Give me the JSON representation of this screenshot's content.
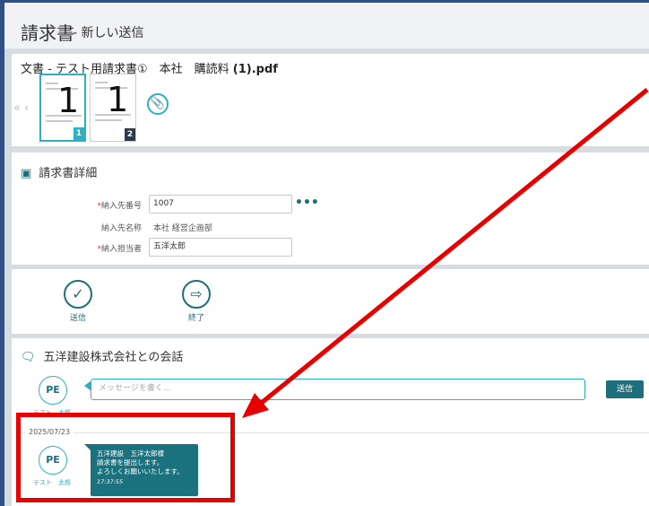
{
  "header": {
    "title": "請求書",
    "subtitle": "- 新しい送信"
  },
  "document": {
    "label": "文書 - テスト用請求書①　本社　購読料",
    "filename": "(1).pdf",
    "nav_prev": "« ‹",
    "pages": [
      {
        "number": "1",
        "badge": "1"
      },
      {
        "number": "1",
        "badge": "2"
      }
    ]
  },
  "details": {
    "heading": "請求書詳細",
    "fields": {
      "payee_no_label": "納入先番号",
      "payee_no_value": "1007",
      "more": "•••",
      "payee_name_label": "納入先名称",
      "payee_name_value": "本社 経営企画部",
      "contact_label": "納入担当者",
      "contact_value": "五洋太郎"
    },
    "required_mark": "*"
  },
  "actions": {
    "send_label": "送信",
    "end_label": "終了"
  },
  "chat": {
    "heading": "五洋建設株式会社との会話",
    "avatar_initials": "PE",
    "avatar_name": "テスト　太郎",
    "placeholder": "メッセージを書く...",
    "send_button": "送信",
    "date": "2025/07/23",
    "message": {
      "line1": "五洋建設　五洋太郎様",
      "line2": "請求書を提出します。",
      "line3": "よろしくお願いいたします。",
      "time": "17:37:55"
    }
  },
  "colors": {
    "accent": "#1d6f7b",
    "accent_light": "#2bb1c1",
    "highlight": "#e60000",
    "frame": "#2f4f86"
  }
}
